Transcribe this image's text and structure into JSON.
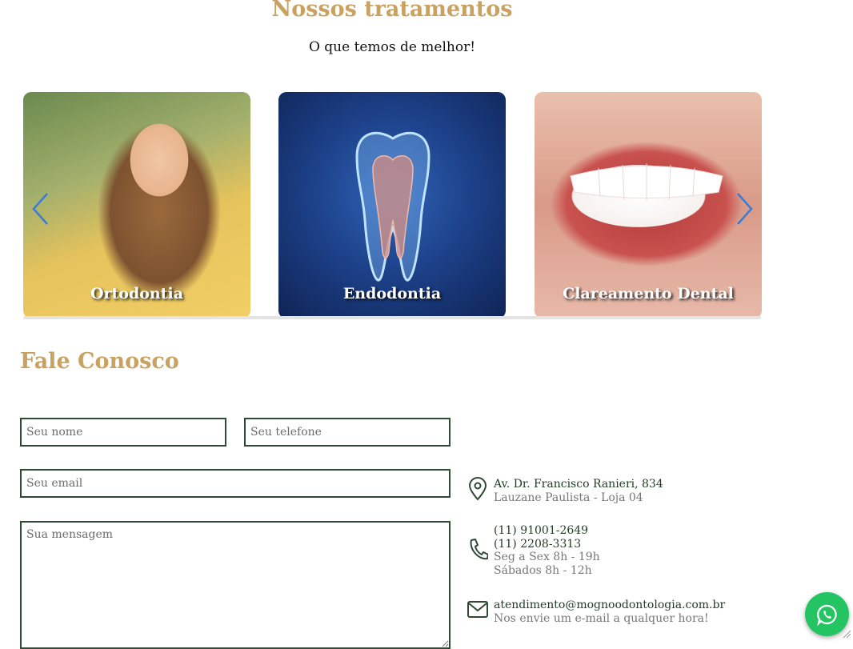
{
  "treatments": {
    "title": "Nossos tratamentos",
    "subtitle": "O que temos de melhor!",
    "cards": [
      {
        "label": "Ortodontia"
      },
      {
        "label": "Endodontia"
      },
      {
        "label": "Clareamento Dental"
      }
    ]
  },
  "contact": {
    "title": "Fale Conosco",
    "form": {
      "name_placeholder": "Seu nome",
      "phone_placeholder": "Seu telefone",
      "email_placeholder": "Seu email",
      "message_placeholder": "Sua mensagem"
    },
    "address": {
      "line1": "Av. Dr. Francisco Ranieri, 834",
      "line2": "Lauzane Paulista - Loja 04"
    },
    "phone": {
      "number1": "(11) 91001-2649",
      "number2": "(11) 2208-3313",
      "hours1": "Seg a Sex 8h - 19h",
      "hours2": "Sábados 8h - 12h"
    },
    "email": {
      "address": "atendimento@mognoodontologia.com.br",
      "note": "Nos envie um e-mail a qualquer hora!"
    }
  },
  "icons": {
    "carousel_prev": "chevron-left-icon",
    "carousel_next": "chevron-right-icon",
    "address": "map-pin-icon",
    "phone": "phone-icon",
    "email": "mail-icon",
    "whatsapp": "whatsapp-icon"
  },
  "colors": {
    "accent_gold": "#c9a262",
    "dark_green": "#2f4a33",
    "arrow_blue": "#3a7bd5",
    "whatsapp_green": "#25c463"
  }
}
